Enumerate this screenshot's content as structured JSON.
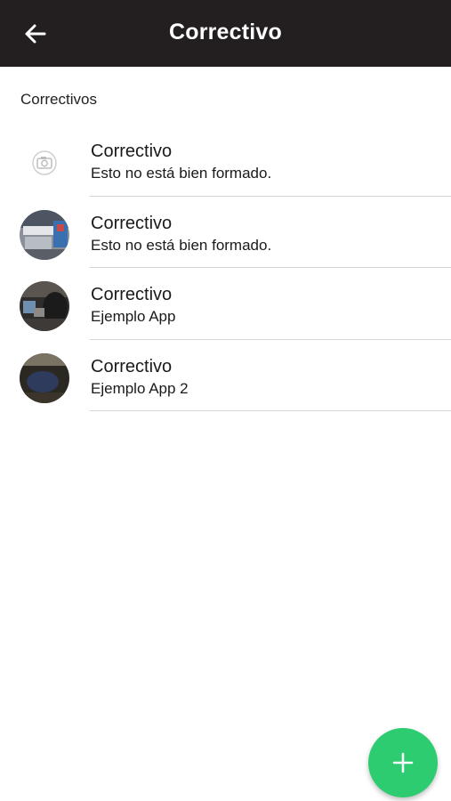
{
  "header": {
    "title": "Correctivo",
    "back_icon": "arrow-back-icon",
    "background": "#231f20"
  },
  "section": {
    "label": "Correctivos"
  },
  "items": [
    {
      "title": "Correctivo",
      "subtitle": "Esto no está bien formado.",
      "image": "camera-placeholder-icon"
    },
    {
      "title": "Correctivo",
      "subtitle": "Esto no está bien formado.",
      "image": "photo-thumbnail"
    },
    {
      "title": "Correctivo",
      "subtitle": "Ejemplo App",
      "image": "photo-thumbnail"
    },
    {
      "title": "Correctivo",
      "subtitle": "Ejemplo App 2",
      "image": "photo-thumbnail"
    }
  ],
  "fab": {
    "icon": "plus-icon",
    "color": "#2ecc71"
  }
}
